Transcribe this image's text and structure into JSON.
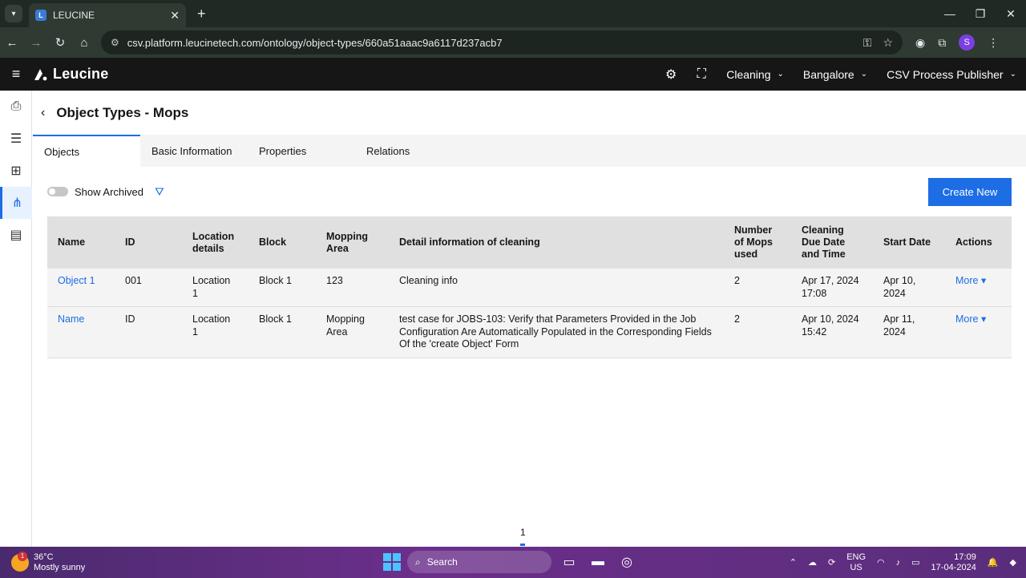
{
  "browser": {
    "tab_title": "LEUCINE",
    "tab_favicon": "L",
    "url": "csv.platform.leucinetech.com/ontology/object-types/660a51aaac9a6117d237acb7",
    "profile_initial": "S"
  },
  "header": {
    "brand": "Leucine",
    "dropdowns": [
      "Cleaning",
      "Bangalore",
      "CSV Process Publisher"
    ]
  },
  "page": {
    "title": "Object Types - Mops",
    "tabs": [
      "Objects",
      "Basic Information",
      "Properties",
      "Relations"
    ],
    "active_tab": "Objects",
    "show_archived_label": "Show Archived",
    "create_button": "Create New",
    "page_number": "1"
  },
  "table": {
    "headers": [
      "Name",
      "ID",
      "Location details",
      "Block",
      "Mopping Area",
      "Detail information of cleaning",
      "Number of Mops used",
      "Cleaning Due Date and Time",
      "Start Date",
      "Actions"
    ],
    "rows": [
      {
        "name": "Object 1",
        "id": "001",
        "location": "Location 1",
        "block": "Block 1",
        "mopping_area": "123",
        "detail": "Cleaning info",
        "mops": "2",
        "due": "Apr 17, 2024 17:08",
        "start": "Apr 10, 2024",
        "action": "More"
      },
      {
        "name": "Name",
        "id": "ID",
        "location": "Location 1",
        "block": "Block 1",
        "mopping_area": "Mopping Area",
        "detail": "test case for JOBS-103: Verify that Parameters Provided in the Job Configuration Are Automatically Populated in the Corresponding Fields Of the 'create Object' Form",
        "mops": "2",
        "due": "Apr 10, 2024 15:42",
        "start": "Apr 11, 2024",
        "action": "More"
      }
    ]
  },
  "taskbar": {
    "weather_temp": "36°C",
    "weather_desc": "Mostly sunny",
    "weather_badge": "1",
    "search_placeholder": "Search",
    "lang_top": "ENG",
    "lang_bottom": "US",
    "time": "17:09",
    "date": "17-04-2024"
  },
  "colors": {
    "accent": "#1d6de5",
    "header_bg": "#161616",
    "table_header_bg": "#e0e0e0"
  }
}
